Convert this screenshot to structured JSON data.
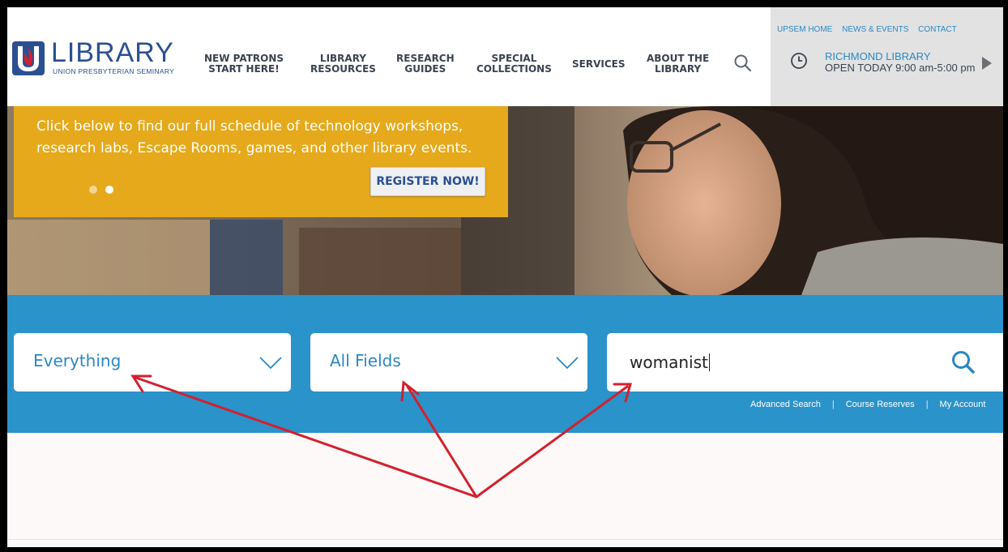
{
  "header": {
    "logo": {
      "title": "LIBRARY",
      "subtitle": "UNION PRESBYTERIAN SEMINARY"
    },
    "nav": [
      {
        "line1": "NEW PATRONS",
        "line2": "START HERE!"
      },
      {
        "line1": "LIBRARY",
        "line2": "RESOURCES"
      },
      {
        "line1": "RESEARCH",
        "line2": "GUIDES"
      },
      {
        "line1": "SPECIAL",
        "line2": "COLLECTIONS"
      },
      {
        "line1": "SERVICES",
        "line2": ""
      },
      {
        "line1": "ABOUT THE",
        "line2": "LIBRARY"
      }
    ],
    "search_icon": "search-icon",
    "info": {
      "top_links": [
        "UPSEM HOME",
        "NEWS & EVENTS",
        "CONTACT"
      ],
      "library_name": "RICHMOND LIBRARY",
      "hours": "OPEN TODAY 9:00 am-5:00 pm",
      "clock_icon": "clock-icon",
      "arrow_icon": "play-arrow-icon"
    }
  },
  "hero": {
    "promo_text": "Click below to find our full schedule of technology workshops, research labs, Escape Rooms, games, and other library events.",
    "register_label": "REGISTER NOW!",
    "slides": 2,
    "active_slide": 2
  },
  "search": {
    "scope": "Everything",
    "field": "All Fields",
    "query": "womanist",
    "links": [
      "Advanced Search",
      "Course Reserves",
      "My Account"
    ]
  },
  "colors": {
    "brand_blue": "#2a5092",
    "link_blue": "#2a88c2",
    "band_blue": "#2a93c9",
    "promo_gold": "#e5a91b",
    "annotation_red": "#d3202e"
  }
}
